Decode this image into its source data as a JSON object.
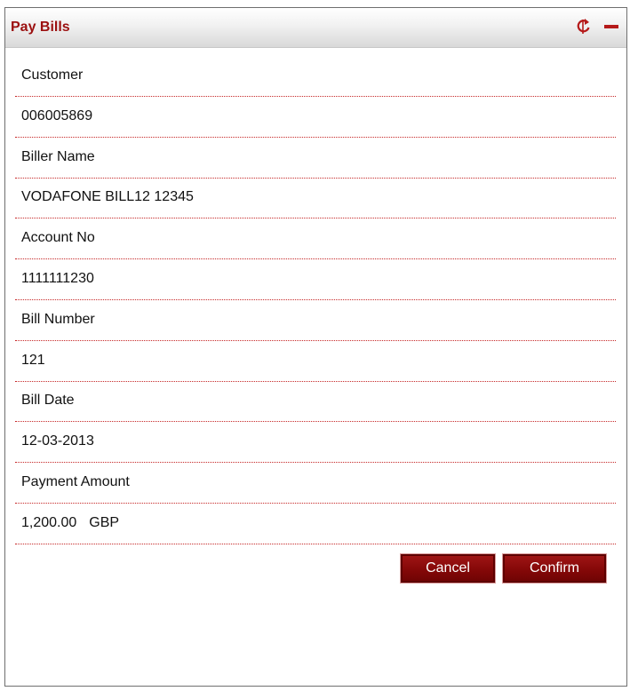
{
  "panel": {
    "title": "Pay Bills",
    "icons": {
      "refresh": "refresh-icon",
      "minimize": "minimize-icon"
    },
    "accent_color": "#9b1010"
  },
  "form": {
    "customer_label": "Customer",
    "customer_value": "006005869",
    "biller_name_label": "Biller Name",
    "biller_name_value": "VODAFONE BILL12 12345",
    "account_no_label": "Account No",
    "account_no_value": "1111111230",
    "bill_number_label": "Bill Number",
    "bill_number_value": "121",
    "bill_date_label": "Bill Date",
    "bill_date_value": "12-03-2013",
    "payment_amount_label": "Payment Amount",
    "payment_amount_value": "1,200.00",
    "payment_currency": "GBP"
  },
  "actions": {
    "cancel_label": "Cancel",
    "confirm_label": "Confirm"
  }
}
